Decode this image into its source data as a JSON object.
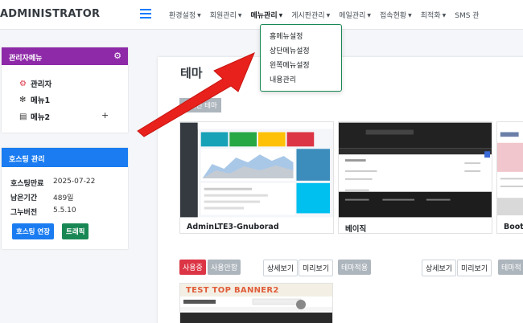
{
  "brand": "ADMINISTRATOR",
  "nav": {
    "items": [
      {
        "label": "환경설정",
        "active": false
      },
      {
        "label": "회원관리",
        "active": false
      },
      {
        "label": "메뉴관리",
        "active": true
      },
      {
        "label": "게시판관리",
        "active": false
      },
      {
        "label": "메일관리",
        "active": false
      },
      {
        "label": "접속현황",
        "active": false
      },
      {
        "label": "최적화",
        "active": false
      },
      {
        "label": "SMS 관",
        "active": false
      }
    ],
    "dropdown": [
      "홈메뉴설정",
      "상단메뉴설정",
      "왼쪽메뉴설정",
      "내용관리"
    ]
  },
  "sidebar": {
    "admin_menu": {
      "title": "관리자메뉴",
      "items": [
        {
          "label": "관리자",
          "icon": "settings-icon"
        },
        {
          "label": "메뉴1",
          "icon": "asterisk-icon"
        },
        {
          "label": "메뉴2",
          "icon": "calendar-icon"
        }
      ]
    },
    "hosting": {
      "title": "호스팅 관리",
      "rows": [
        {
          "key": "호스팅만료",
          "value": "2025-07-22"
        },
        {
          "key": "남은기간",
          "value": "489일"
        },
        {
          "key": "그누버전",
          "value": "5.5.10"
        }
      ],
      "extend_button": "호스팅 연장",
      "traffic_button": "트래픽"
    }
  },
  "main": {
    "title": "테마",
    "installed_badge": "설치된 테마",
    "themes": [
      {
        "name": "AdminLTE3-Gnuborad",
        "buttons": [
          "사용중",
          "사용안함",
          "상세보기",
          "미리보기"
        ]
      },
      {
        "name": "베이직",
        "buttons": [
          "테마적용",
          "상세보기",
          "미리보기"
        ]
      },
      {
        "name": "Bootst",
        "buttons": [
          "테마적"
        ]
      }
    ],
    "banner": {
      "title": "TEST TOP BANNER2"
    }
  },
  "colors": {
    "primary": "#1a7cf0",
    "purple": "#8e2aa8",
    "green": "#198754",
    "danger": "#dc3545",
    "arrow": "#e8211c"
  }
}
